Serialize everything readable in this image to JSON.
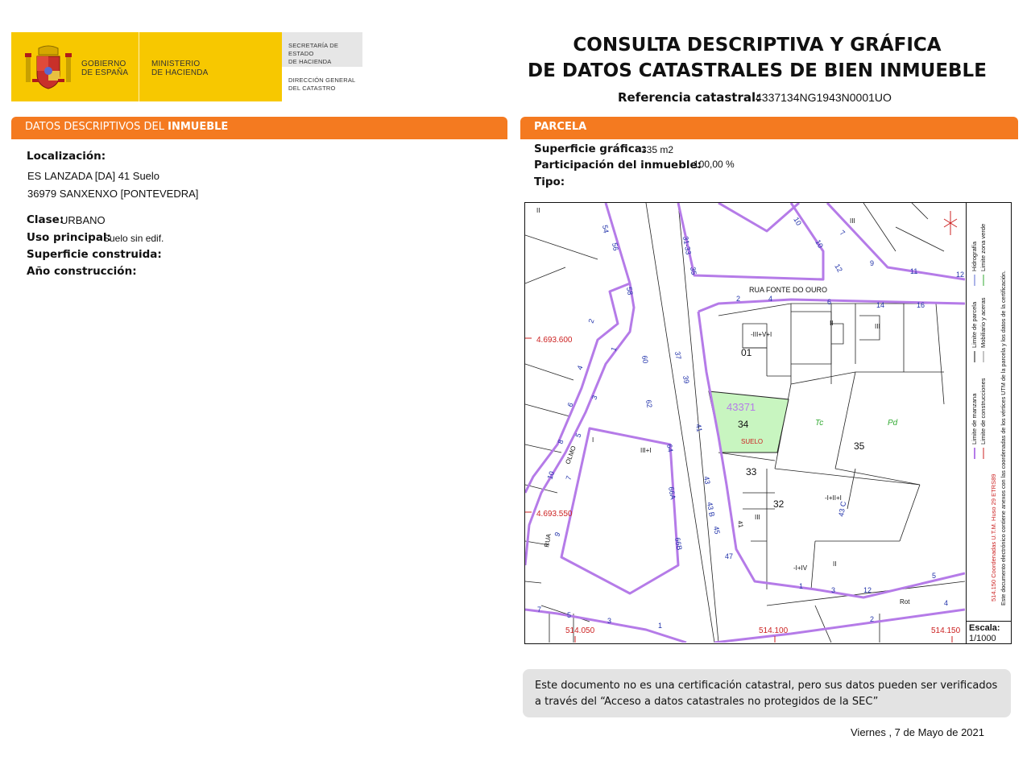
{
  "header": {
    "gov_line1": "GOBIERNO",
    "gov_line2": "DE ESPAÑA",
    "min_line1": "MINISTERIO",
    "min_line2": "DE HACIENDA",
    "sec_line1": "SECRETARÍA DE ESTADO",
    "sec_line2": "DE HACIENDA",
    "dg_line1": "DIRECCIÓN GENERAL",
    "dg_line2": "DEL CATASTRO",
    "title_line1": "CONSULTA DESCRIPTIVA Y GRÁFICA",
    "title_line2": "DE DATOS CATASTRALES DE BIEN INMUEBLE",
    "ref_label": "Referencia catastral:",
    "ref_value": "4337134NG1943N0001UO"
  },
  "left_section": {
    "title_a": "DATOS DESCRIPTIVOS DEL ",
    "title_b": "INMUEBLE",
    "localizacion_label": "Localización:",
    "address_line1": "ES LANZADA [DA] 41 Suelo",
    "address_line2": "36979 SANXENXO [PONTEVEDRA]",
    "clase_label": "Clase:",
    "clase_value": "URBANO",
    "uso_label": "Uso principal:",
    "uso_value": "Suelo sin edif.",
    "superficie_label": "Superficie construida:",
    "anio_label": "Año construcción:"
  },
  "right_section": {
    "title": "PARCELA",
    "sup_grafica_label": "Superficie gráfica:",
    "sup_grafica_value": "335 m2",
    "participacion_label": "Participación del inmueble:",
    "participacion_value": "100,00 %",
    "tipo_label": "Tipo:"
  },
  "map": {
    "street_top": "RUA FONTE DO OURO",
    "street_left": "RUA",
    "street_olmo": "OLMO",
    "parcel_id": "43371",
    "parcel_num": "34",
    "parcel_use": "SUELO",
    "coord_y1": "4.693.600",
    "coord_y2": "4.693.550",
    "coord_x1": "514.050",
    "coord_x2": "514.100",
    "coord_x3": "514.150",
    "legend_manzana": "Limite de manzana",
    "legend_parcela": "Limite de parcela",
    "legend_hidrografia": "Hidrografía",
    "legend_construcciones": "Limite de construcciones",
    "legend_mobiliario": "Mobiliario y aceras",
    "legend_verde": "Limite zona verde",
    "legend_coords": "514.150 Coordenadas U.T.M. Huso 29 ETRS89",
    "legend_note": "Este documento electrónico contiene anexos con las coordenadas de los vértices UTM de la parcela y los datos de la certificación.",
    "scale_label": "Escala:",
    "scale_value": "1/1000",
    "colors": {
      "manzana": "#b57be8",
      "parcel_fill": "#c8f5c0",
      "coord_red": "#cc2222",
      "number_blue": "#2233aa",
      "green_text": "#33aa33"
    }
  },
  "footer": {
    "note": "Este documento no es una certificación catastral, pero sus datos pueden ser verificados a través del “Acceso a datos catastrales no protegidos de la SEC”",
    "date": "Viernes , 7 de Mayo de 2021"
  }
}
